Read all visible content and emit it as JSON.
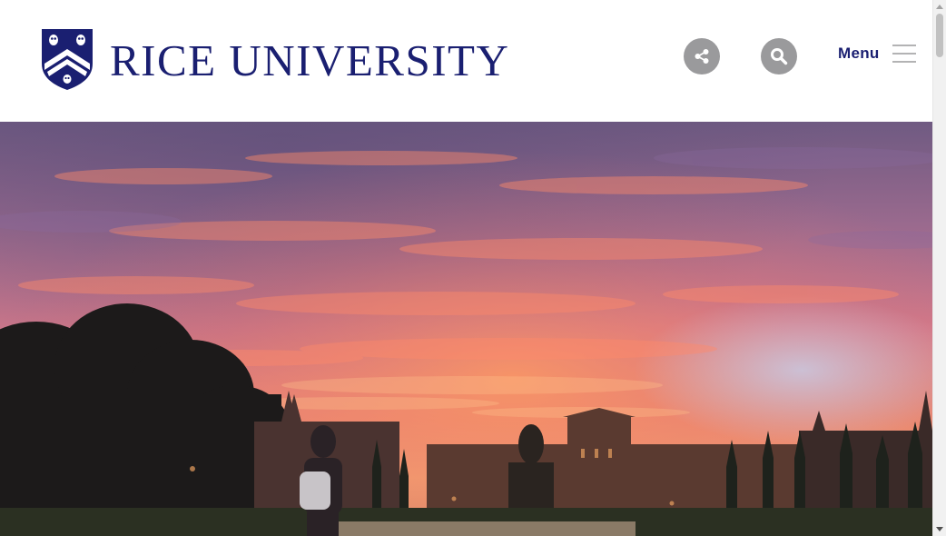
{
  "header": {
    "wordmark": "RICE UNIVERSITY",
    "logo_icon": "rice-owl-shield-icon",
    "share_icon": "share-icon",
    "search_icon": "search-icon",
    "menu_label": "Menu",
    "menu_icon": "hamburger-icon"
  },
  "hero": {
    "image_description_icon": "campus-sunset-photo"
  },
  "colors": {
    "brand_blue": "#1a1f71",
    "icon_button_gray": "#9a9a9c",
    "header_bg": "#ffffff"
  }
}
